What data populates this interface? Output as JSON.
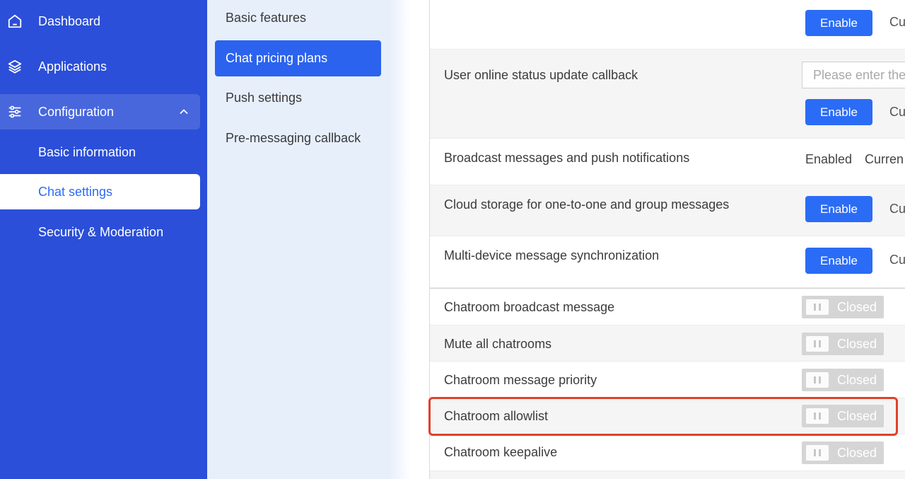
{
  "sidebar": {
    "items": [
      {
        "label": "Dashboard",
        "icon": "home-icon"
      },
      {
        "label": "Applications",
        "icon": "layers-icon"
      },
      {
        "label": "Configuration",
        "icon": "sliders-icon"
      }
    ],
    "sub_items": [
      {
        "label": "Basic information"
      },
      {
        "label": "Chat settings"
      },
      {
        "label": "Security & Moderation"
      }
    ]
  },
  "subpanel": {
    "items": [
      {
        "label": "Basic features"
      },
      {
        "label": "Chat pricing plans"
      },
      {
        "label": "Push settings"
      },
      {
        "label": "Pre-messaging callback"
      }
    ]
  },
  "settings": {
    "enable_label": "Enable",
    "cut_label": "Cu",
    "rows": [
      {
        "label": "User online status update callback",
        "placeholder": "Please enter the"
      },
      {
        "label": "Broadcast messages and push notifications",
        "status": "Enabled",
        "current": "Curren"
      },
      {
        "label": "Cloud storage for one-to-one and group messages"
      },
      {
        "label": "Multi-device message synchronization"
      }
    ],
    "toggle_rows": [
      {
        "label": "Chatroom broadcast message",
        "state": "Closed"
      },
      {
        "label": "Mute all chatrooms",
        "state": "Closed"
      },
      {
        "label": "Chatroom message priority",
        "state": "Closed"
      },
      {
        "label": "Chatroom allowlist",
        "state": "Closed"
      },
      {
        "label": "Chatroom keepalive",
        "state": "Closed"
      }
    ]
  },
  "colors": {
    "sidebar_bg": "#2b4fd8",
    "accent": "#2b6cf6",
    "highlight": "#e0412c"
  }
}
